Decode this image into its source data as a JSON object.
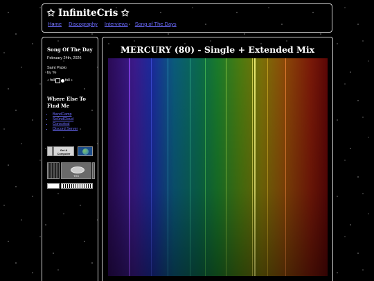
{
  "header": {
    "site_title": "✩ InfiniteCris ✩",
    "nav": [
      "Home",
      "Discography",
      "Interviews",
      "Song of The Days"
    ]
  },
  "sidebar": {
    "sotd_heading": "Song Of The Day",
    "sotd_date": "February 24th, 2026",
    "sotd_song": "Saint Pablo",
    "sotd_artist": "by Ye",
    "player_left": "♪ fsll",
    "player_right": "fsll ♪",
    "where_heading": "Where Else To Find Me",
    "links": [
      "BandCamp",
      "SoundCloud",
      "Consoleal",
      "Discord Server"
    ],
    "badges": [
      "Get A Computer",
      "THX"
    ]
  },
  "main": {
    "post_title": "MERCURY (80) - Single + Extended Mix"
  },
  "colors": {
    "link": "#6b6bff",
    "border": "#cfcfcf",
    "background": "#000000"
  }
}
